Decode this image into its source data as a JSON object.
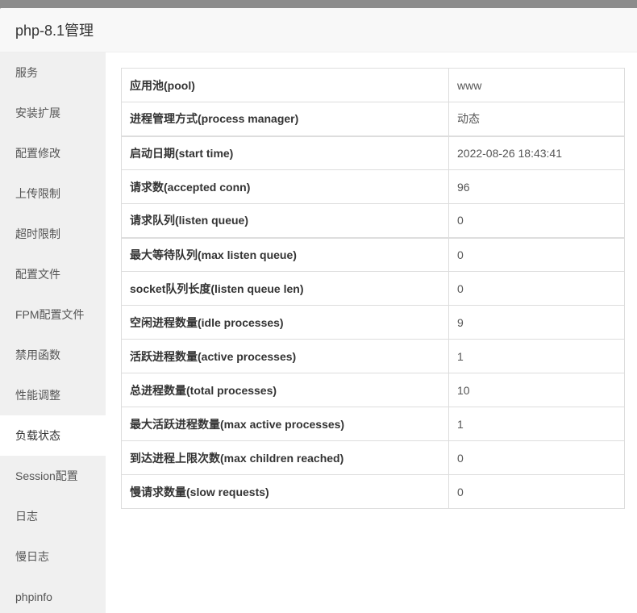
{
  "window": {
    "title": "php-8.1管理"
  },
  "sidebar": {
    "items": [
      {
        "label": "服务"
      },
      {
        "label": "安装扩展"
      },
      {
        "label": "配置修改"
      },
      {
        "label": "上传限制"
      },
      {
        "label": "超时限制"
      },
      {
        "label": "配置文件"
      },
      {
        "label": "FPM配置文件"
      },
      {
        "label": "禁用函数"
      },
      {
        "label": "性能调整"
      },
      {
        "label": "负载状态",
        "active": true
      },
      {
        "label": "Session配置"
      },
      {
        "label": "日志"
      },
      {
        "label": "慢日志"
      },
      {
        "label": "phpinfo"
      }
    ]
  },
  "status_table": {
    "rows": [
      {
        "key": "应用池(pool)",
        "value": "www"
      },
      {
        "key": "进程管理方式(process manager)",
        "value": "动态"
      },
      {
        "key": "启动日期(start time)",
        "value": "2022-08-26 18:43:41"
      },
      {
        "key": "请求数(accepted conn)",
        "value": "96"
      },
      {
        "key": "请求队列(listen queue)",
        "value": "0"
      },
      {
        "key": "最大等待队列(max listen queue)",
        "value": "0"
      },
      {
        "key": "socket队列长度(listen queue len)",
        "value": "0"
      },
      {
        "key": "空闲进程数量(idle processes)",
        "value": "9"
      },
      {
        "key": "活跃进程数量(active processes)",
        "value": "1"
      },
      {
        "key": "总进程数量(total processes)",
        "value": "10"
      },
      {
        "key": "最大活跃进程数量(max active processes)",
        "value": "1"
      },
      {
        "key": "到达进程上限次数(max children reached)",
        "value": "0"
      },
      {
        "key": "慢请求数量(slow requests)",
        "value": "0"
      }
    ]
  }
}
